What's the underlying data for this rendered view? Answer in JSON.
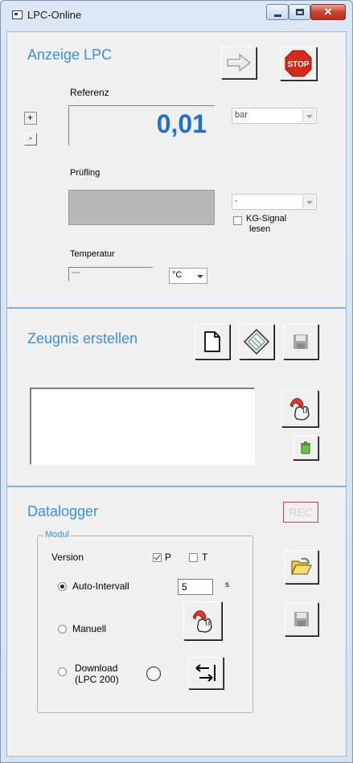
{
  "window": {
    "title": "LPC-Online",
    "close_glyph": "✕"
  },
  "anzeige": {
    "title": "Anzeige LPC",
    "referenz_label": "Referenz",
    "referenz_value": "0,01",
    "referenz_unit": "bar",
    "zoom_plus": "+",
    "zoom_minus": "-",
    "pruefling_label": "Prüfling",
    "pruefling_value": "",
    "pruefling_unit": "-",
    "kg_signal_label_1": "KG-Signal",
    "kg_signal_label_2": "lesen",
    "temperatur_label": "Temperatur",
    "temperatur_value": "---",
    "temperatur_unit": "°C",
    "stop_label": "STOP"
  },
  "zeugnis": {
    "title": "Zeugnis erstellen"
  },
  "datalogger": {
    "title": "Datalogger",
    "rec_label": "REC",
    "modul_legend": "Modul",
    "version_label": "Version",
    "p_label": "P",
    "t_label": "T",
    "p_checked": true,
    "t_checked": false,
    "auto_intervall_label": "Auto-Intervall",
    "interval_value": "5",
    "interval_unit": "s",
    "manuell_label": "Manuell",
    "download_label_1": "Download",
    "download_label_2": "(LPC 200)"
  },
  "colors": {
    "accent": "#3d8fd6",
    "value_blue": "#1f6fd1",
    "stop_red": "#d42a1a",
    "rec_red": "#e04040"
  }
}
